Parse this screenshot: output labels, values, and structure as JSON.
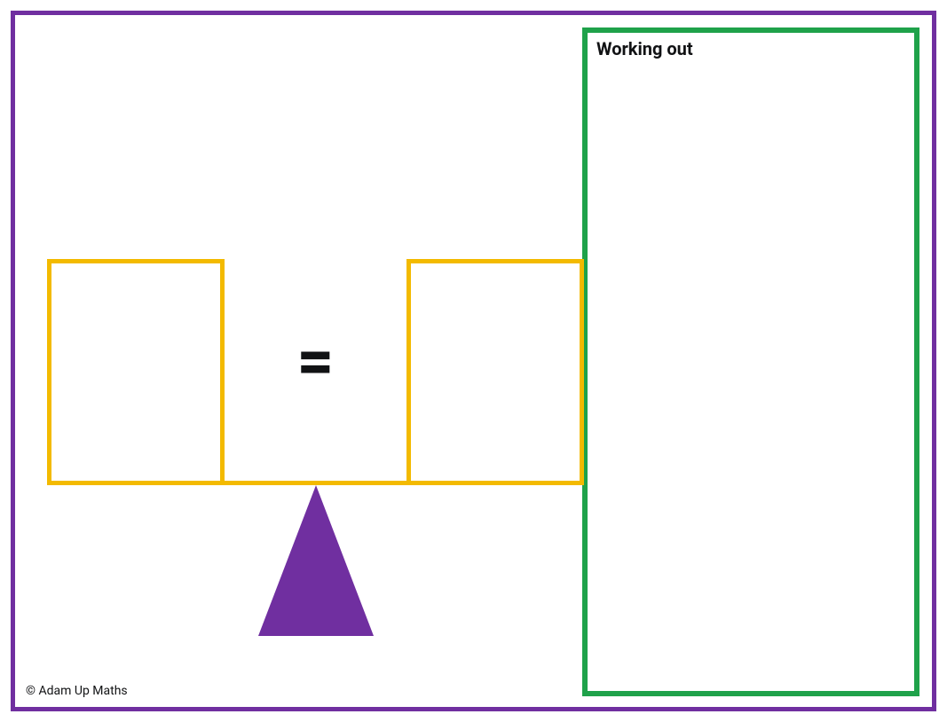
{
  "workingOut": {
    "title": "Working out"
  },
  "balance": {
    "operator": "=",
    "leftBox": "",
    "rightBox": ""
  },
  "copyright": "© Adam Up Maths",
  "colors": {
    "frame": "#702FA0",
    "boxes": "#F3BA00",
    "workingBorder": "#1FA24A",
    "fulcrum": "#702FA0"
  }
}
